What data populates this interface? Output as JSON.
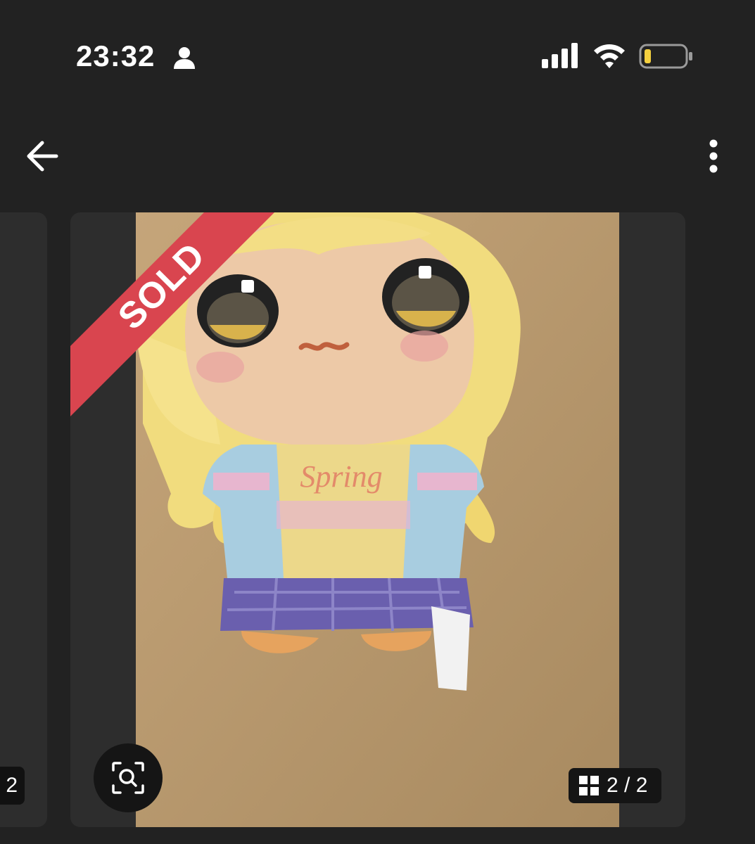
{
  "status_bar": {
    "time": "23:32",
    "icons": [
      "person-icon",
      "signal-icon",
      "wifi-icon",
      "battery-icon"
    ],
    "battery_color": "#f4d03f"
  },
  "toolbar": {
    "back_icon": "arrow-left-icon",
    "more_icon": "more-vertical-icon"
  },
  "carousel": {
    "prev_counter": "2",
    "badge": "SOLD",
    "badge_color": "#d9454f",
    "image_counter": "2 / 2",
    "counter_icon": "grid-icon",
    "zoom_icon": "zoom-search-icon"
  },
  "photo": {
    "shirt_text": "Spring"
  }
}
